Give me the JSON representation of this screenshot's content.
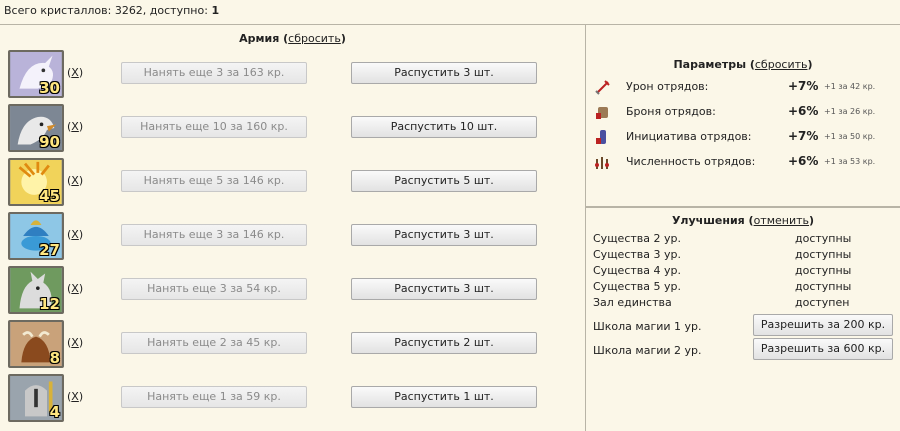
{
  "header": {
    "crystals_label": "Всего кристаллов: 3262, доступно:",
    "crystals_available": "1"
  },
  "army": {
    "title": "Армия",
    "reset_link": "сбросить",
    "units": [
      {
        "count": "30",
        "remove": "X",
        "hire_label": "Нанять еще 3 за 163 кр.",
        "dismiss_label": "Распустить 3 шт."
      },
      {
        "count": "90",
        "remove": "X",
        "hire_label": "Нанять еще 10 за 160 кр.",
        "dismiss_label": "Распустить 10 шт."
      },
      {
        "count": "45",
        "remove": "X",
        "hire_label": "Нанять еще 5 за 146 кр.",
        "dismiss_label": "Распустить 5 шт."
      },
      {
        "count": "27",
        "remove": "X",
        "hire_label": "Нанять еще 3 за 146 кр.",
        "dismiss_label": "Распустить 3 шт."
      },
      {
        "count": "12",
        "remove": "X",
        "hire_label": "Нанять еще 3 за 54 кр.",
        "dismiss_label": "Распустить 3 шт."
      },
      {
        "count": "8",
        "remove": "X",
        "hire_label": "Нанять еще 2 за 45 кр.",
        "dismiss_label": "Распустить 2 шт."
      },
      {
        "count": "4",
        "remove": "X",
        "hire_label": "Нанять еще 1 за 59 кр.",
        "dismiss_label": "Распустить 1 шт."
      }
    ]
  },
  "params": {
    "title": "Параметры",
    "reset_link": "сбросить",
    "rows": [
      {
        "icon": "sword-icon",
        "label": "Урон отрядов:",
        "value": "+7%",
        "note": "+1 за 42 кр."
      },
      {
        "icon": "armor-icon",
        "label": "Броня отрядов:",
        "value": "+6%",
        "note": "+1 за 26 кр."
      },
      {
        "icon": "initiative-icon",
        "label": "Инициатива отрядов:",
        "value": "+7%",
        "note": "+1 за 50 кр."
      },
      {
        "icon": "troops-icon",
        "label": "Численность отрядов:",
        "value": "+6%",
        "note": "+1 за 53 кр."
      }
    ]
  },
  "upgrades": {
    "title": "Улучшения",
    "cancel_link": "отменить",
    "rows": [
      {
        "label": "Существа 2 ур.",
        "status": "доступны"
      },
      {
        "label": "Существа 3 ур.",
        "status": "доступны"
      },
      {
        "label": "Существа 4 ур.",
        "status": "доступны"
      },
      {
        "label": "Существа 5 ур.",
        "status": "доступны"
      },
      {
        "label": "Зал единства",
        "status": "доступен"
      }
    ],
    "magic": [
      {
        "label": "Школа магии 1 ур.",
        "button": "Разрешить за 200 кр."
      },
      {
        "label": "Школа магии 2 ур.",
        "button": "Разрешить за 600 кр."
      }
    ]
  },
  "colors": {
    "background": "#fbf7e8",
    "divider": "#b8b4a6"
  }
}
